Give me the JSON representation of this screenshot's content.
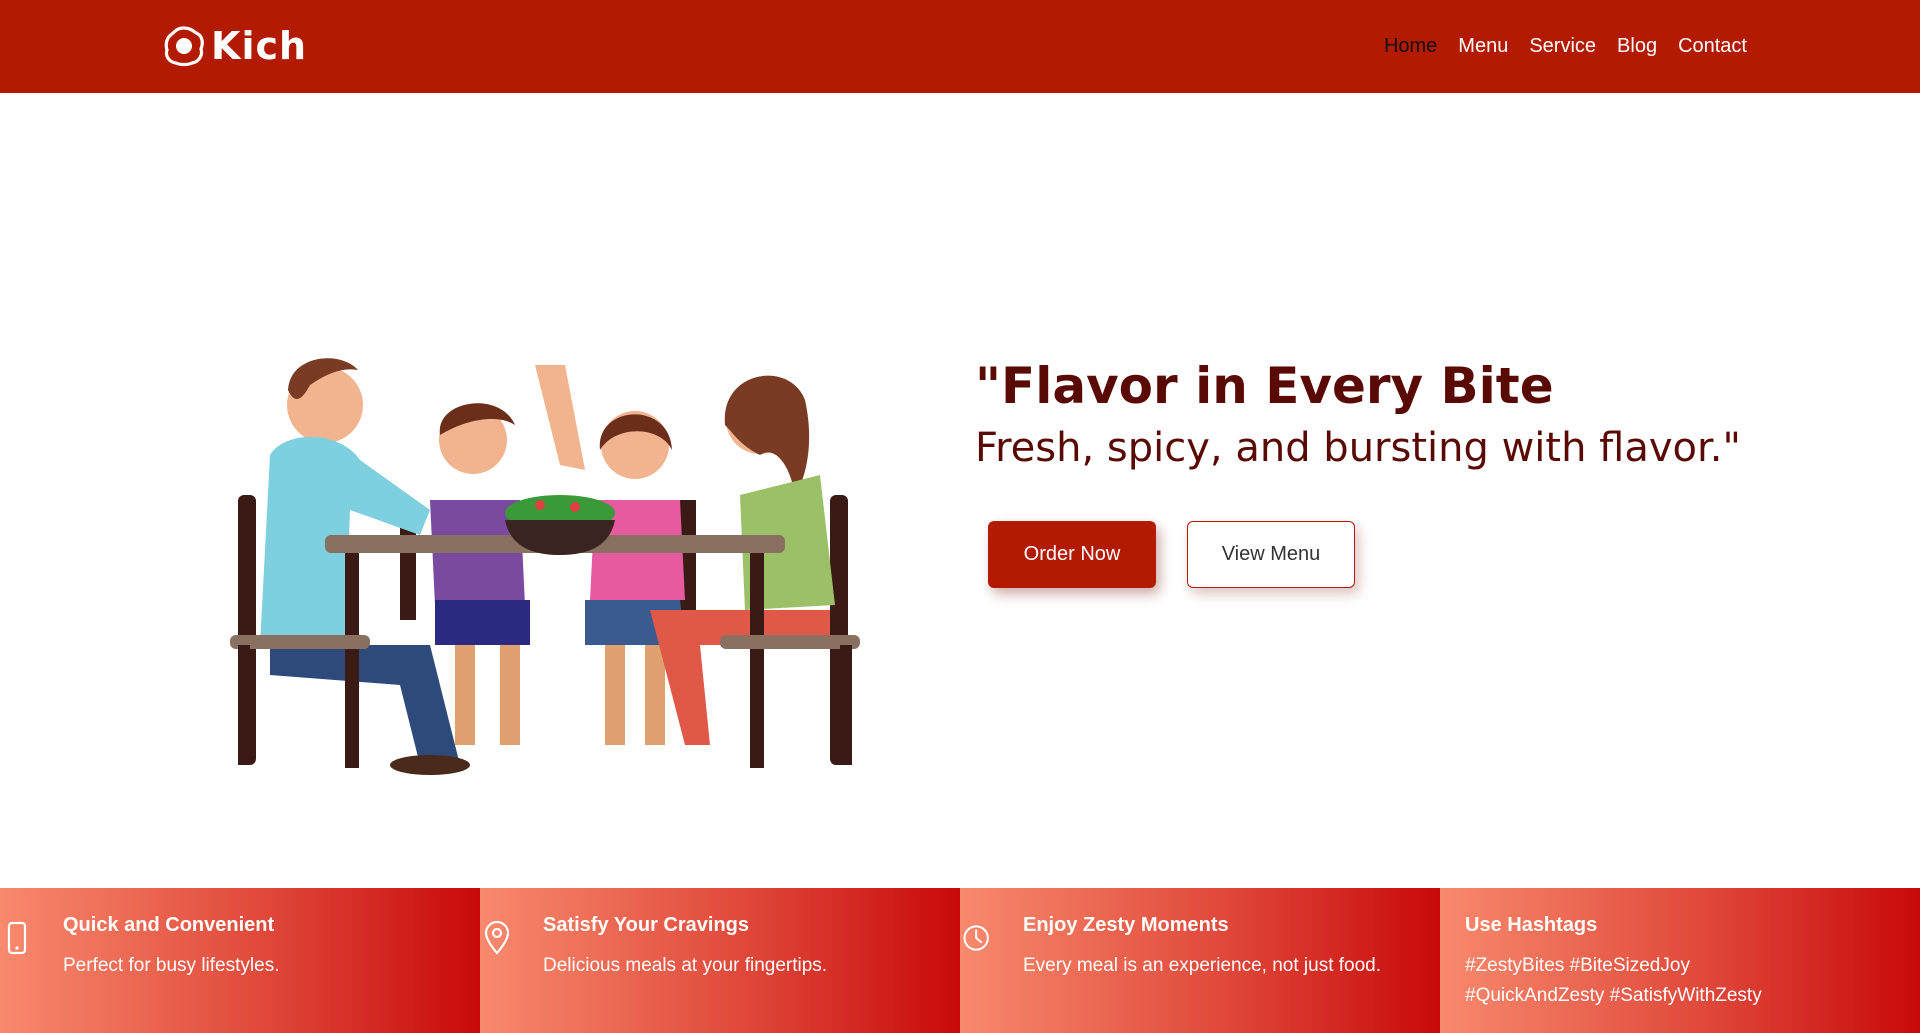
{
  "brand": {
    "name": "Kich",
    "logo_icon": "egg-icon"
  },
  "nav": {
    "items": [
      {
        "label": "Home",
        "active": true
      },
      {
        "label": "Menu",
        "active": false
      },
      {
        "label": "Service",
        "active": false
      },
      {
        "label": "Blog",
        "active": false
      },
      {
        "label": "Contact",
        "active": false
      }
    ]
  },
  "hero": {
    "title": "\"Flavor in Every Bite",
    "subtitle": "Fresh, spicy, and bursting with flavor.\"",
    "order_button": "Order Now",
    "menu_button": "View Menu",
    "illustration": "family-dining-illustration"
  },
  "features": [
    {
      "icon": "mobile-phone-icon",
      "title": "Quick and Convenient",
      "desc": "Perfect for busy lifestyles."
    },
    {
      "icon": "location-pin-icon",
      "title": "Satisfy Your Cravings",
      "desc": "Delicious meals at your fingertips."
    },
    {
      "icon": "clock-icon",
      "title": "Enjoy Zesty Moments",
      "desc": "Every meal is an experience, not just food."
    },
    {
      "icon": "",
      "title": "Use Hashtags",
      "desc_lines": [
        "#ZestyBites #BiteSizedJoy",
        "#QuickAndZesty #SatisfyWithZesty"
      ]
    }
  ],
  "colors": {
    "brand_red": "#b31a02",
    "title_dark_red": "#5a0a04",
    "gradient_start": "#f88a6e",
    "gradient_end": "#c80a0a"
  }
}
